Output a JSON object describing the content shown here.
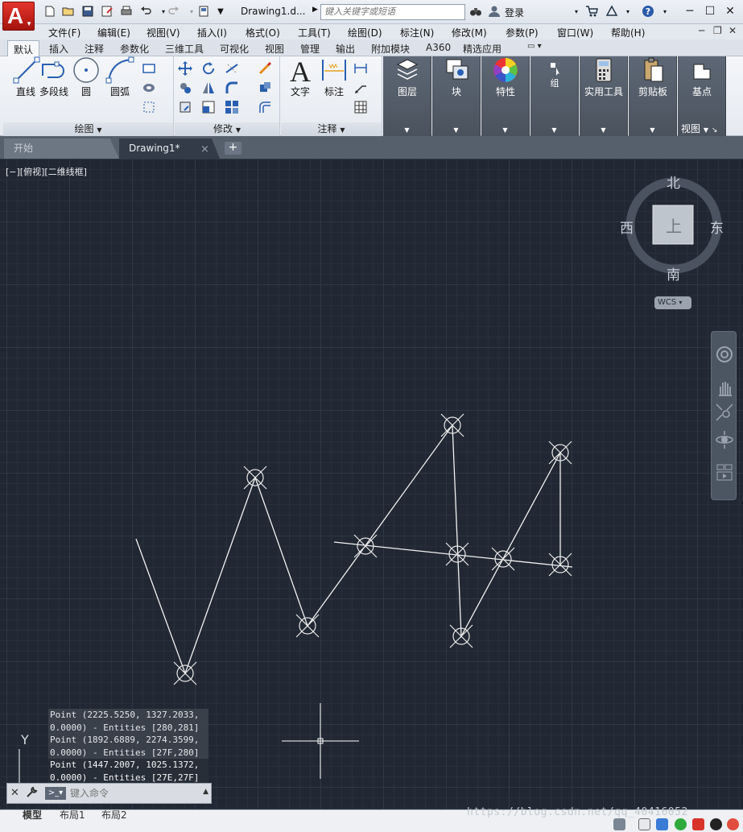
{
  "titlebar": {
    "doc_title": "Drawing1.d...",
    "search_placeholder": "键入关键字或短语",
    "login_label": "登录"
  },
  "menubar": {
    "items": [
      "文件(F)",
      "编辑(E)",
      "视图(V)",
      "插入(I)",
      "格式(O)",
      "工具(T)",
      "绘图(D)",
      "标注(N)",
      "修改(M)",
      "参数(P)",
      "窗口(W)",
      "帮助(H)"
    ]
  },
  "ribbon_tabs": [
    "默认",
    "插入",
    "注释",
    "参数化",
    "三维工具",
    "可视化",
    "视图",
    "管理",
    "输出",
    "附加模块",
    "A360",
    "精选应用"
  ],
  "ribbon": {
    "draw_panel": {
      "title": "绘图",
      "tools": [
        "直线",
        "多段线",
        "圆",
        "圆弧"
      ]
    },
    "modify_panel": {
      "title": "修改"
    },
    "annotate_panel": {
      "title": "注释",
      "tools": [
        "文字",
        "标注"
      ]
    },
    "layers_label": "图层",
    "block_label": "块",
    "properties_label": "特性",
    "group_label": "组",
    "utilities_label": "实用工具",
    "clipboard_label": "剪贴板",
    "base_label": "基点",
    "view_panel_title": "视图"
  },
  "filetabs": {
    "start_label": "开始",
    "drawing_label": "Drawing1*",
    "close_glyph": "×",
    "add_glyph": "+"
  },
  "canvas": {
    "viewport_label": "[−][俯视][二维线框]",
    "viewcube": {
      "north": "北",
      "south": "南",
      "east": "东",
      "west": "西",
      "face": "上",
      "wcs": "WCS"
    },
    "ucs_y_label": "Y"
  },
  "command": {
    "history": [
      "Point (2225.5250, 1327.2033, 0.0000) - Entities [280,281]",
      "Point (1892.6889, 2274.3599, 0.0000) - Entities [27F,280]",
      "Point (1447.2007, 1025.1372, 0.0000) - Entities [27E,27F]"
    ],
    "placeholder": "键入命令"
  },
  "layout_tabs": [
    "模型",
    "布局1",
    "布局2"
  ],
  "watermark": "https://blog.csdn.net/qq_40416052"
}
